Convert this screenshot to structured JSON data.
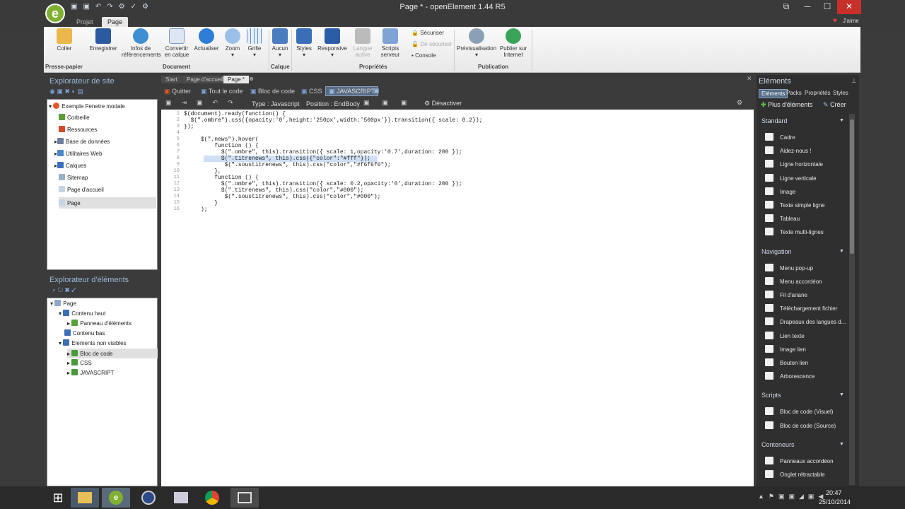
{
  "window": {
    "title": "Page * - openElement 1.44 R5",
    "jaime": "J'aime"
  },
  "ribbon_tabs": [
    "Projet",
    "Page"
  ],
  "ribbon": {
    "buttons": [
      "Coller",
      "Enregistrer",
      "Infos de\nréférencements",
      "Convertir\nen calque",
      "Actualiser",
      "Zoom",
      "Grille",
      "Aucun",
      "Styles",
      "Responsive",
      "Langue\nactive",
      "Scripts\nserveur",
      "Prévisualisation",
      "Publier sur\nInternet"
    ],
    "small": [
      "Sécuriser",
      "Dé-sécuriser",
      "Console"
    ],
    "groups": [
      "Presse-papier",
      "Document",
      "Calque",
      "Propriétés",
      "Publication"
    ]
  },
  "site_explorer": {
    "title": "Explorateur de site",
    "items": [
      "Exemple Fenetre modale",
      "Corbeille",
      "Ressources",
      "Base de données",
      "Utilitaires Web",
      "Calques",
      "Sitemap",
      "Page d'accueil",
      "Page"
    ]
  },
  "element_explorer": {
    "title": "Explorateur d'éléments",
    "items": [
      "Page",
      "Contenu haut",
      "Panneau d'éléments",
      "Contenu bas",
      "Elements non visibles",
      "Bloc de code",
      "CSS",
      "JAVASCRIPT"
    ]
  },
  "doc_tabs": [
    "Start",
    "Page d'accueil",
    "Page *"
  ],
  "code_toolbar": [
    "Quitter",
    "Tout le code",
    "Bloc de code",
    "CSS",
    "JAVASCRIPT"
  ],
  "code_toolbar2": {
    "type": "Type : Javascript",
    "position": "Position : EndBody",
    "disable": "Désactiver"
  },
  "code_lines": [
    "$(document).ready(function() {",
    "  $(\".ombre\").css({opacity:'0',height:'250px',width:'500px'}).transition({ scale: 0.2});",
    "});",
    "",
    "     $(\".news\").hover(",
    "         function () {",
    "           $(\".ombre\", this).transition({ scale: 1,opacity:'0.7',duration: 200 });",
    "           $(\".titrenews\", this).css({\"color\":\"#fff\"});",
    "            $(\".soustitrenews\", this).css(\"color\",\"#f6f6f6\");",
    "         },",
    "         function () {",
    "           $(\".ombre\", this).transition({ scale: 0.2,opacity:'0',duration: 200 });",
    "           $(\".titrenews\", this).css(\"color\",\"#000\");",
    "            $(\".soustitrenews\", this).css(\"color\",\"#000\");",
    "         }",
    "     );"
  ],
  "elements_panel": {
    "title": "Eléments",
    "tabs": [
      "Eléments",
      "Packs",
      "Propriétés",
      "Styles"
    ],
    "more": "Plus d'éléments",
    "create": "Créer",
    "sections": [
      {
        "name": "Standard",
        "items": [
          "Cadre",
          "Aidez-nous !",
          "Ligne horizontale",
          "Ligne verticale",
          "Image",
          "Texte simple ligne",
          "Tableau",
          "Texte multi-lignes"
        ]
      },
      {
        "name": "Navigation",
        "items": [
          "Menu pop-up",
          "Menu accordéon",
          "Fil d'ariane",
          "Téléchargement fichier",
          "Drapeaux des langues d...",
          "Lien texte",
          "Image lien",
          "Bouton lien",
          "Arborescence"
        ]
      },
      {
        "name": "Scripts",
        "items": [
          "Bloc de code (Visuel)",
          "Bloc de code (Source)"
        ]
      },
      {
        "name": "Conteneurs",
        "items": [
          "Panneaux accordéon",
          "Onglet rétractable"
        ]
      }
    ]
  },
  "clock": {
    "time": "20:47",
    "date": "25/10/2014"
  },
  "colors": {
    "accent": "#9bb8d8",
    "ribbon_bg": "#f2f2f2"
  }
}
